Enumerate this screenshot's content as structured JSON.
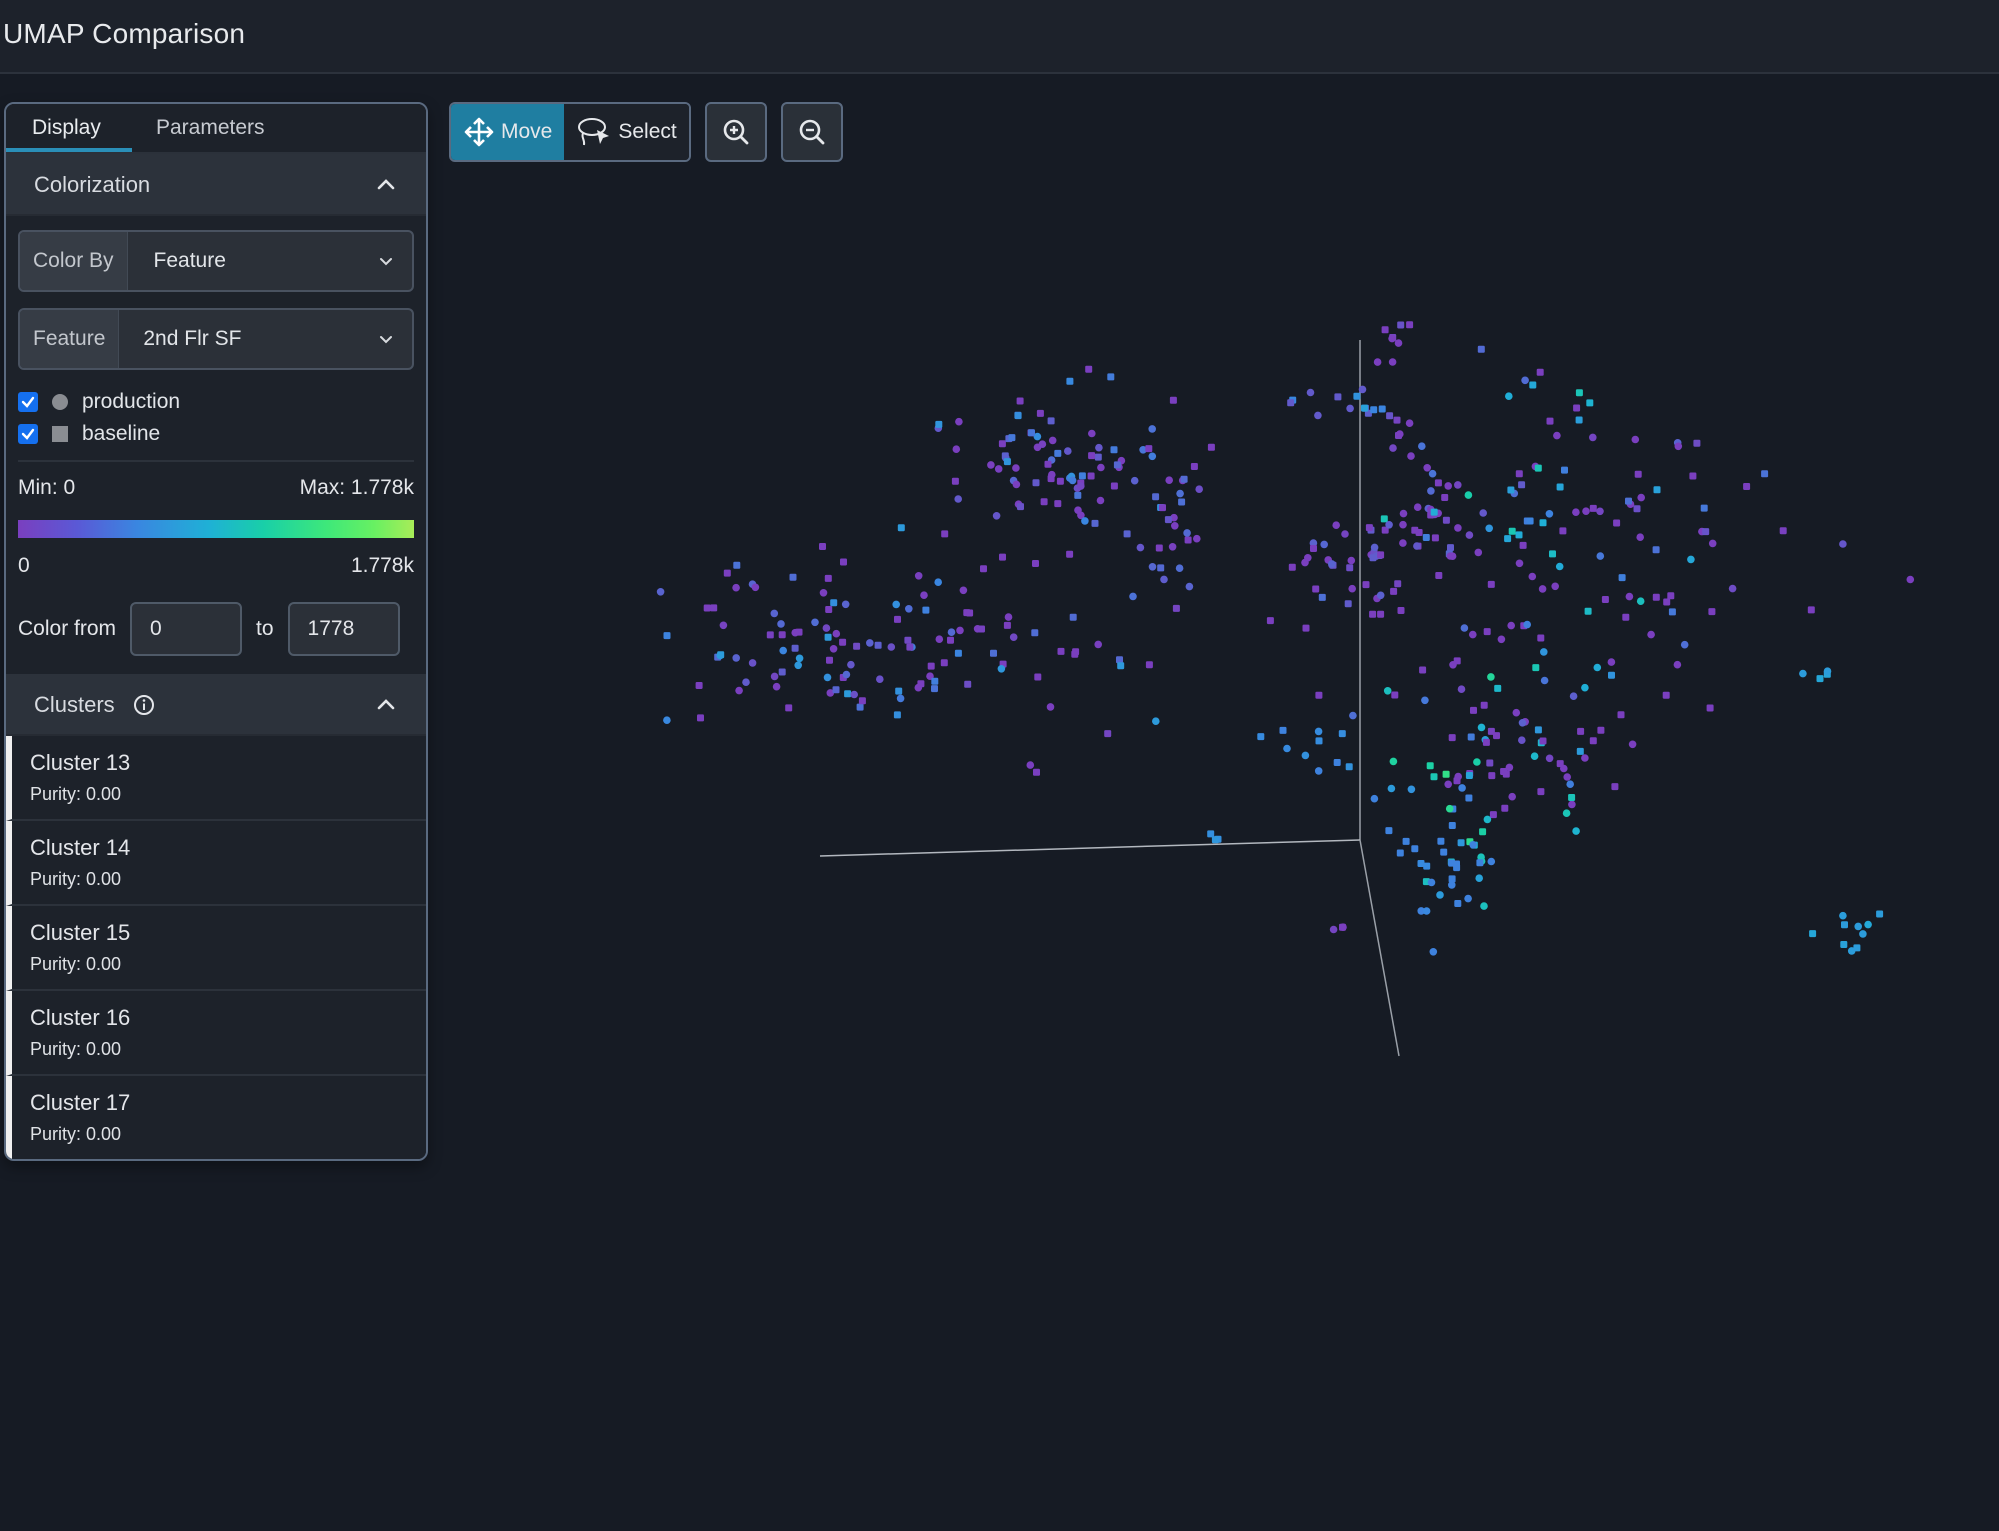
{
  "header": {
    "title": "UMAP Comparison"
  },
  "panel": {
    "tabs": [
      {
        "label": "Display",
        "active": true
      },
      {
        "label": "Parameters",
        "active": false
      }
    ],
    "colorization": {
      "title": "Colorization",
      "color_by_label": "Color By",
      "color_by_value": "Feature",
      "feature_label": "Feature",
      "feature_value": "2nd Flr SF",
      "datasets": [
        {
          "label": "production",
          "checked": true,
          "shape": "circle"
        },
        {
          "label": "baseline",
          "checked": true,
          "shape": "square"
        }
      ],
      "min_label": "Min: 0",
      "max_label": "Max: 1.778k",
      "scale_min_tick": "0",
      "scale_max_tick": "1.778k",
      "color_from_label": "Color from",
      "color_from_value": "0",
      "to_label": "to",
      "color_to_value": "1778",
      "gradient_colors": [
        "#7a3fbf",
        "#3a86e0",
        "#1fb0d6",
        "#3ee87a",
        "#a8ec58"
      ]
    },
    "clusters": {
      "title": "Clusters",
      "items": [
        {
          "name": "Cluster 13",
          "purity": "Purity: 0.00"
        },
        {
          "name": "Cluster 14",
          "purity": "Purity: 0.00"
        },
        {
          "name": "Cluster 15",
          "purity": "Purity: 0.00"
        },
        {
          "name": "Cluster 16",
          "purity": "Purity: 0.00"
        },
        {
          "name": "Cluster 17",
          "purity": "Purity: 0.00"
        }
      ]
    }
  },
  "toolbar": {
    "move_label": "Move",
    "select_label": "Select",
    "active_mode": "move"
  },
  "chart_data": {
    "type": "scatter",
    "title": "UMAP Comparison",
    "color_feature": "2nd Flr SF",
    "color_range": [
      0,
      1778
    ],
    "series": [
      {
        "name": "production",
        "marker": "circle"
      },
      {
        "name": "baseline",
        "marker": "square"
      }
    ],
    "projection": "3d",
    "point_groups": [
      {
        "center": [
          1.05,
          0.42
        ],
        "spread": [
          0.09,
          0.05
        ],
        "count": 40,
        "value_range": [
          0,
          300
        ]
      },
      {
        "center": [
          1.14,
          0.53
        ],
        "spread": [
          0.03,
          0.04
        ],
        "count": 14,
        "value_range": [
          0,
          500
        ]
      },
      {
        "center": [
          0.95,
          0.72
        ],
        "spread": [
          0.04,
          0.02
        ],
        "count": 12,
        "value_range": [
          200,
          700
        ]
      },
      {
        "center": [
          1.07,
          0.85
        ],
        "spread": [
          0.02,
          0.03
        ],
        "count": 8,
        "value_range": [
          0,
          150
        ]
      },
      {
        "center": [
          0.4,
          0.58
        ],
        "spread": [
          0.1,
          0.07
        ],
        "count": 70,
        "value_range": [
          0,
          700
        ]
      },
      {
        "center": [
          0.32,
          0.68
        ],
        "spread": [
          0.02,
          0.02
        ],
        "count": 5,
        "value_range": [
          400,
          700
        ]
      },
      {
        "center": [
          0.62,
          0.47
        ],
        "spread": [
          0.04,
          0.08
        ],
        "count": 30,
        "value_range": [
          0,
          400
        ]
      },
      {
        "center": [
          1.08,
          0.68
        ],
        "spread": [
          0.02,
          0.02
        ],
        "count": 6,
        "value_range": [
          0,
          200
        ]
      },
      {
        "center": [
          1.38,
          0.43
        ],
        "spread": [
          0.22,
          0.16
        ],
        "count": 130,
        "value_range": [
          0,
          1100
        ]
      },
      {
        "center": [
          0.02,
          0.22
        ],
        "spread": [
          0.24,
          0.08
        ],
        "count": 120,
        "value_range": [
          0,
          700
        ]
      },
      {
        "center": [
          1.3,
          0.01
        ],
        "spread": [
          0.12,
          0.08
        ],
        "count": 60,
        "value_range": [
          0,
          1400
        ]
      },
      {
        "center": [
          1.17,
          -0.18
        ],
        "spread": [
          0.07,
          0.08
        ],
        "count": 40,
        "value_range": [
          500,
          1300
        ]
      },
      {
        "center": [
          1.9,
          0.18
        ],
        "spread": [
          0.02,
          0.01
        ],
        "count": 4,
        "value_range": [
          700,
          800
        ]
      },
      {
        "center": [
          2.0,
          -0.35
        ],
        "spread": [
          0.04,
          0.03
        ],
        "count": 10,
        "value_range": [
          700,
          800
        ]
      },
      {
        "center": [
          0.7,
          -0.14
        ],
        "spread": [
          0.01,
          0.01
        ],
        "count": 3,
        "value_range": [
          600,
          700
        ]
      },
      {
        "center": [
          0.95,
          -0.32
        ],
        "spread": [
          0.01,
          0.01
        ],
        "count": 3,
        "value_range": [
          0,
          50
        ]
      },
      {
        "center": [
          0.9,
          0.05
        ],
        "spread": [
          0.06,
          0.04
        ],
        "count": 10,
        "value_range": [
          500,
          700
        ]
      }
    ]
  }
}
